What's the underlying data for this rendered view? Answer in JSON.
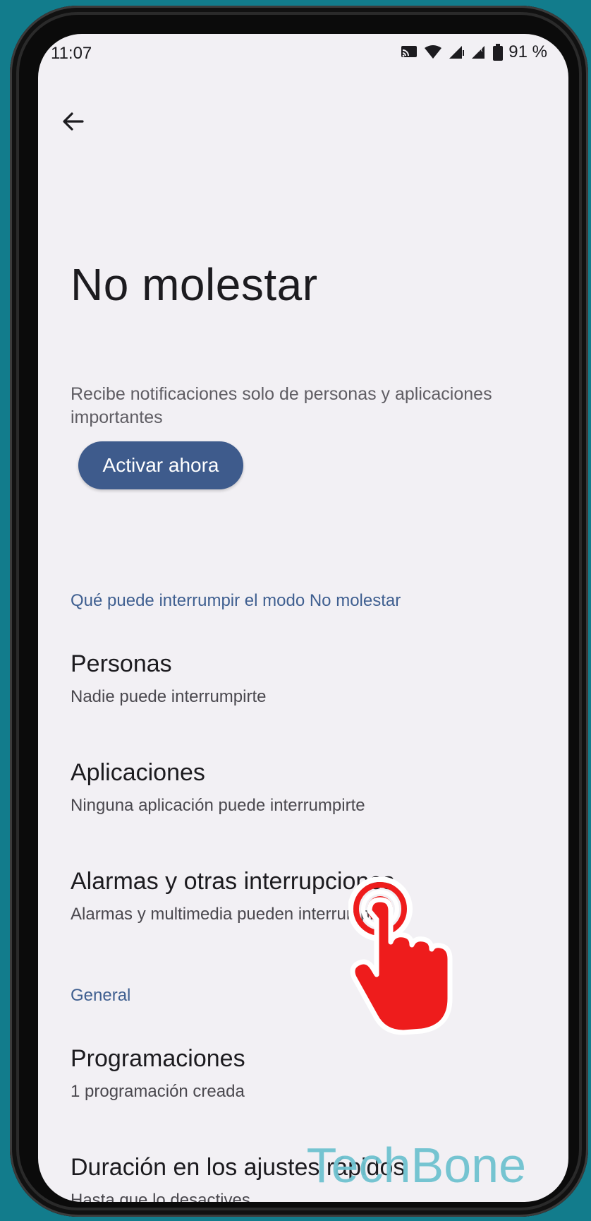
{
  "status_bar": {
    "time": "11:07",
    "battery": "91 %",
    "icons": [
      "cast-icon",
      "wifi-icon",
      "signal-icon",
      "signal-roaming-icon",
      "battery-icon"
    ]
  },
  "header": {
    "back_icon": "arrow-left-icon",
    "title": "No molestar"
  },
  "description": "Recibe notificaciones solo de personas y aplicaciones importantes",
  "activate_button": "Activar ahora",
  "sections": [
    {
      "header": "Qué puede interrumpir el modo No molestar",
      "items": [
        {
          "title": "Personas",
          "subtitle": "Nadie puede interrumpirte"
        },
        {
          "title": "Aplicaciones",
          "subtitle": "Ninguna aplicación puede interrumpirte"
        },
        {
          "title": "Alarmas y otras interrupciones",
          "subtitle": "Alarmas y multimedia pueden interrumpirte"
        }
      ]
    },
    {
      "header": "General",
      "items": [
        {
          "title": "Programaciones",
          "subtitle": "1 programación creada"
        },
        {
          "title": "Duración en los ajustes rápidos",
          "subtitle": "Hasta que lo desactives"
        }
      ]
    }
  ],
  "watermark": "TechBone",
  "tap_indicator_icon": "tap-hand-icon",
  "colors": {
    "background": "#127c8c",
    "screen": "#f2f0f4",
    "accent": "#3e5b8c",
    "section_header": "#3f5f90",
    "tap_hand": "#ee1c1c",
    "watermark": "#6fc2d0"
  }
}
